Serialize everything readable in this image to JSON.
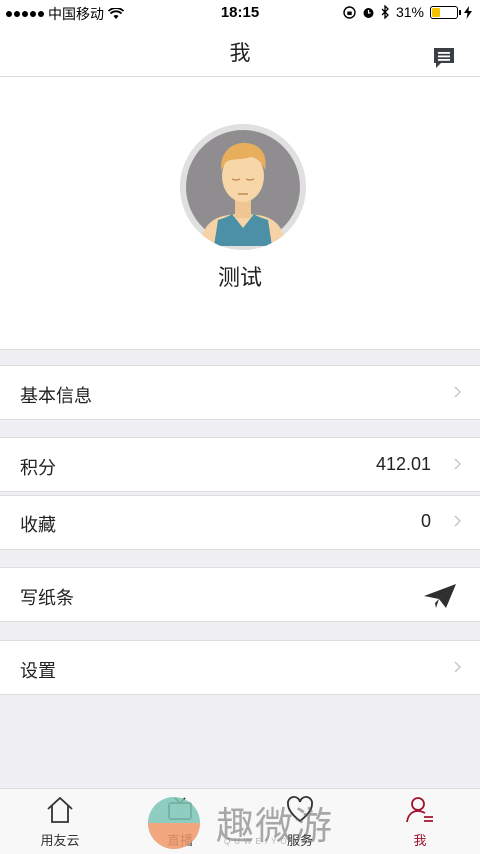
{
  "status_bar": {
    "carrier": "中国移动",
    "time": "18:15",
    "battery": "31%",
    "battery_level": 0.31
  },
  "nav": {
    "title": "我",
    "message_icon": "message-icon"
  },
  "profile": {
    "username": "测试",
    "avatar_icon": "avatar-person"
  },
  "rows": {
    "basic_info": "基本信息",
    "points_label": "积分",
    "points_value": "412.01",
    "favorites_label": "收藏",
    "favorites_value": "0",
    "note_label": "写纸条",
    "settings_label": "设置"
  },
  "tabs": [
    {
      "label": "用友云",
      "icon": "home-icon"
    },
    {
      "label": "直播",
      "icon": "live-icon"
    },
    {
      "label": "服务",
      "icon": "service-icon"
    },
    {
      "label": "我",
      "icon": "user-icon",
      "active": true
    }
  ],
  "watermark": {
    "text": "趣微游",
    "sub": "QUWEIYOU"
  },
  "colors": {
    "accent": "#a0142f",
    "background": "#efeff4",
    "battery_fill": "#f2c200"
  }
}
